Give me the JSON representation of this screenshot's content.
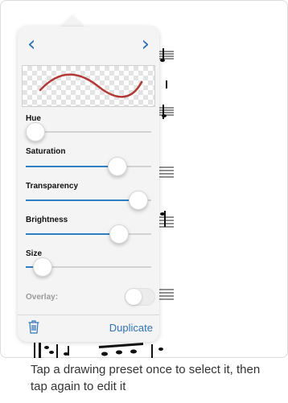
{
  "panel": {
    "nav": {
      "prev_icon": "chevron-left-icon",
      "next_icon": "chevron-right-icon"
    },
    "preview": {
      "stroke_color": "#b23a36"
    },
    "sliders": [
      {
        "label": "Hue",
        "value": 0.0,
        "filled": false
      },
      {
        "label": "Saturation",
        "value": 0.77,
        "filled": true
      },
      {
        "label": "Transparency",
        "value": 0.97,
        "filled": true
      },
      {
        "label": "Brightness",
        "value": 0.79,
        "filled": true
      },
      {
        "label": "Size",
        "value": 0.07,
        "filled": true
      }
    ],
    "overlay": {
      "label": "Overlay:",
      "on": false
    },
    "footer": {
      "delete_icon": "trash-icon",
      "duplicate_label": "Duplicate"
    }
  },
  "caption": "Tap a drawing preset once to select it, then tap again to edit it",
  "colors": {
    "accent": "#2f73b7",
    "slider_fill": "#2e7fc1"
  }
}
